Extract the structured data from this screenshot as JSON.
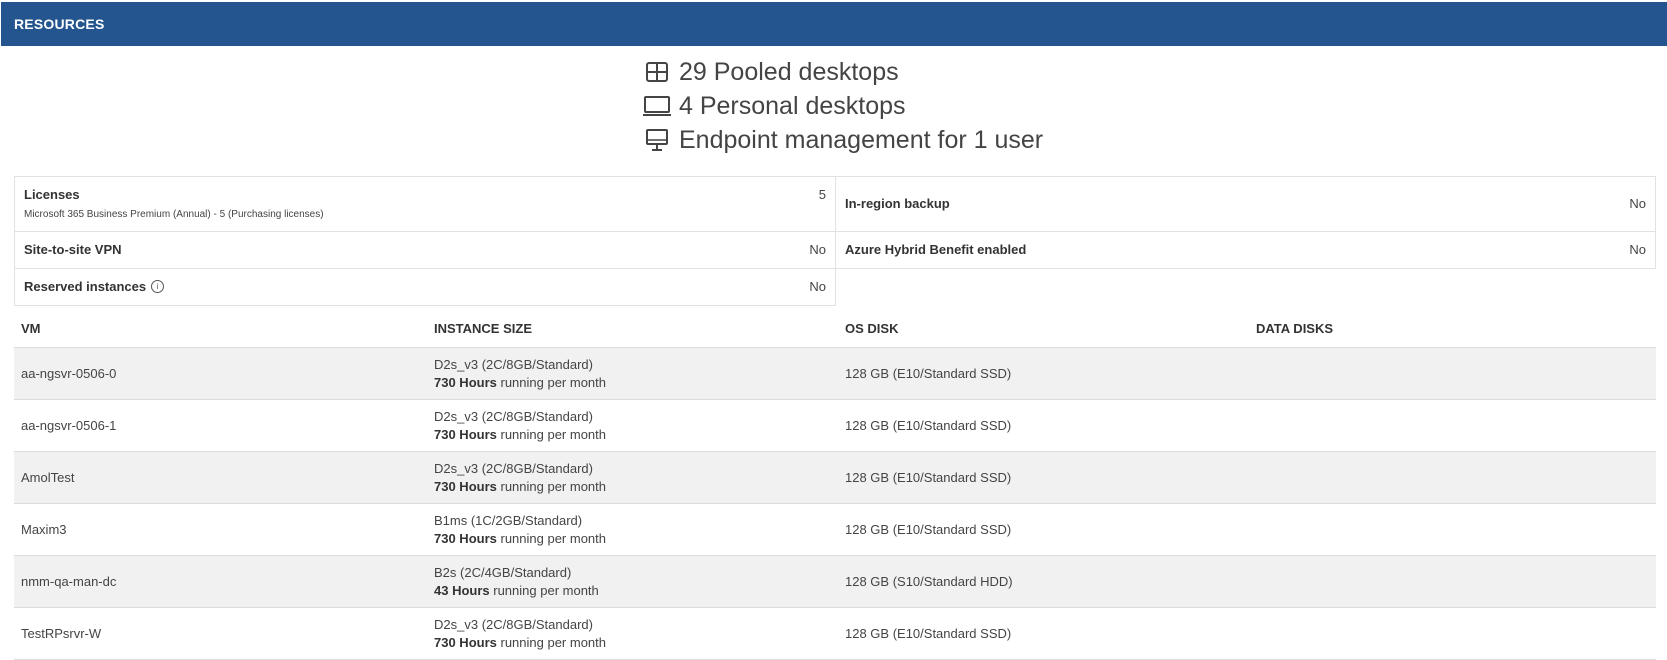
{
  "header": {
    "title": "RESOURCES"
  },
  "summary": {
    "pooled": "29 Pooled desktops",
    "personal": "4 Personal desktops",
    "endpoint": "Endpoint management for 1 user",
    "icons": [
      "grid-icon",
      "monitor-icon",
      "desktop-icon"
    ]
  },
  "properties": {
    "licenses_label": "Licenses",
    "licenses_detail": "Microsoft 365 Business Premium (Annual) - 5 (Purchasing licenses)",
    "licenses_value": "5",
    "backup_label": "In-region backup",
    "backup_value": "No",
    "vpn_label": "Site-to-site VPN",
    "vpn_value": "No",
    "ahb_label": "Azure Hybrid Benefit enabled",
    "ahb_value": "No",
    "reserved_label": "Reserved instances",
    "reserved_value": "No",
    "info_glyph": "i"
  },
  "table": {
    "headers": [
      "VM",
      "INSTANCE SIZE",
      "OS DISK",
      "DATA DISKS"
    ],
    "hours_suffix": " running per month",
    "rows": [
      {
        "vm": "aa-ngsvr-0506-0",
        "size": "D2s_v3 (2C/8GB/Standard)",
        "hours": "730 Hours",
        "os_disk": "128 GB (E10/Standard SSD)",
        "data_disks": ""
      },
      {
        "vm": "aa-ngsvr-0506-1",
        "size": "D2s_v3 (2C/8GB/Standard)",
        "hours": "730 Hours",
        "os_disk": "128 GB (E10/Standard SSD)",
        "data_disks": ""
      },
      {
        "vm": "AmolTest",
        "size": "D2s_v3 (2C/8GB/Standard)",
        "hours": "730 Hours",
        "os_disk": "128 GB (E10/Standard SSD)",
        "data_disks": ""
      },
      {
        "vm": "Maxim3",
        "size": "B1ms (1C/2GB/Standard)",
        "hours": "730 Hours",
        "os_disk": "128 GB (E10/Standard SSD)",
        "data_disks": ""
      },
      {
        "vm": "nmm-qa-man-dc",
        "size": "B2s (2C/4GB/Standard)",
        "hours": "43 Hours",
        "os_disk": "128 GB (S10/Standard HDD)",
        "data_disks": ""
      },
      {
        "vm": "TestRPsrvr-W",
        "size": "D2s_v3 (2C/8GB/Standard)",
        "hours": "730 Hours",
        "os_disk": "128 GB (E10/Standard SSD)",
        "data_disks": ""
      }
    ]
  }
}
